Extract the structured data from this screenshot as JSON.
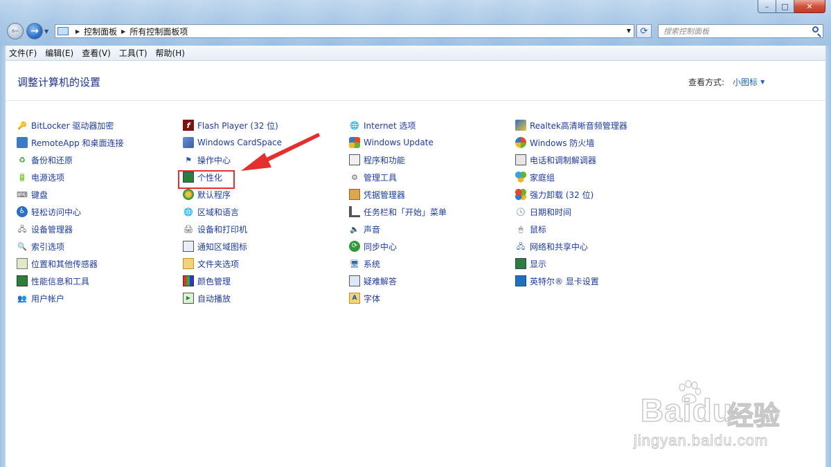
{
  "window": {
    "controls": {
      "minimize": "–",
      "maximize": "□",
      "close": "✕"
    }
  },
  "nav": {
    "back_glyph": "←",
    "forward_glyph": "→"
  },
  "address": {
    "crumbs": [
      "控制面板",
      "所有控制面板项"
    ]
  },
  "search": {
    "placeholder": "搜索控制面板"
  },
  "menubar": [
    "文件(F)",
    "编辑(E)",
    "查看(V)",
    "工具(T)",
    "帮助(H)"
  ],
  "page": {
    "title": "调整计算机的设置",
    "view_by_label": "查看方式:",
    "view_by_value": "小图标"
  },
  "columns": [
    [
      {
        "label": "BitLocker 驱动器加密",
        "icon": "bitlocker-icon"
      },
      {
        "label": "RemoteApp 和桌面连接",
        "icon": "remoteapp-icon"
      },
      {
        "label": "备份和还原",
        "icon": "backup-icon"
      },
      {
        "label": "电源选项",
        "icon": "power-icon"
      },
      {
        "label": "键盘",
        "icon": "keyboard-icon"
      },
      {
        "label": "轻松访问中心",
        "icon": "ease-of-access-icon"
      },
      {
        "label": "设备管理器",
        "icon": "device-manager-icon"
      },
      {
        "label": "索引选项",
        "icon": "indexing-icon"
      },
      {
        "label": "位置和其他传感器",
        "icon": "sensor-icon"
      },
      {
        "label": "性能信息和工具",
        "icon": "performance-icon"
      },
      {
        "label": "用户帐户",
        "icon": "user-accounts-icon"
      }
    ],
    [
      {
        "label": "Flash Player (32 位)",
        "icon": "flash-icon"
      },
      {
        "label": "Windows CardSpace",
        "icon": "cardspace-icon"
      },
      {
        "label": "操作中心",
        "icon": "flag-icon"
      },
      {
        "label": "个性化",
        "icon": "personalization-icon"
      },
      {
        "label": "默认程序",
        "icon": "default-programs-icon"
      },
      {
        "label": "区域和语言",
        "icon": "region-icon"
      },
      {
        "label": "设备和打印机",
        "icon": "printer-icon"
      },
      {
        "label": "通知区域图标",
        "icon": "notification-icon"
      },
      {
        "label": "文件夹选项",
        "icon": "folder-options-icon"
      },
      {
        "label": "颜色管理",
        "icon": "color-management-icon"
      },
      {
        "label": "自动播放",
        "icon": "autoplay-icon"
      }
    ],
    [
      {
        "label": "Internet 选项",
        "icon": "internet-icon"
      },
      {
        "label": "Windows Update",
        "icon": "windows-update-icon"
      },
      {
        "label": "程序和功能",
        "icon": "programs-icon"
      },
      {
        "label": "管理工具",
        "icon": "admin-tools-icon"
      },
      {
        "label": "凭据管理器",
        "icon": "credential-icon"
      },
      {
        "label": "任务栏和「开始」菜单",
        "icon": "taskbar-icon"
      },
      {
        "label": "声音",
        "icon": "sound-icon"
      },
      {
        "label": "同步中心",
        "icon": "sync-icon"
      },
      {
        "label": "系统",
        "icon": "system-icon"
      },
      {
        "label": "疑难解答",
        "icon": "troubleshoot-icon"
      },
      {
        "label": "字体",
        "icon": "fonts-icon"
      }
    ],
    [
      {
        "label": "Realtek高清晰音频管理器",
        "icon": "realtek-icon"
      },
      {
        "label": "Windows 防火墙",
        "icon": "firewall-icon"
      },
      {
        "label": "电话和调制解调器",
        "icon": "phone-modem-icon"
      },
      {
        "label": "家庭组",
        "icon": "homegroup-icon"
      },
      {
        "label": "强力卸载 (32 位)",
        "icon": "uninstall-icon"
      },
      {
        "label": "日期和时间",
        "icon": "clock-icon"
      },
      {
        "label": "鼠标",
        "icon": "mouse-icon"
      },
      {
        "label": "网络和共享中心",
        "icon": "network-icon"
      },
      {
        "label": "显示",
        "icon": "display-icon"
      },
      {
        "label": "英特尔® 显卡设置",
        "icon": "intel-graphics-icon"
      }
    ]
  ],
  "watermark": {
    "brand": "Bai",
    "brand2": "du",
    "cn": "经验",
    "url": "jingyan.baidu.com"
  }
}
